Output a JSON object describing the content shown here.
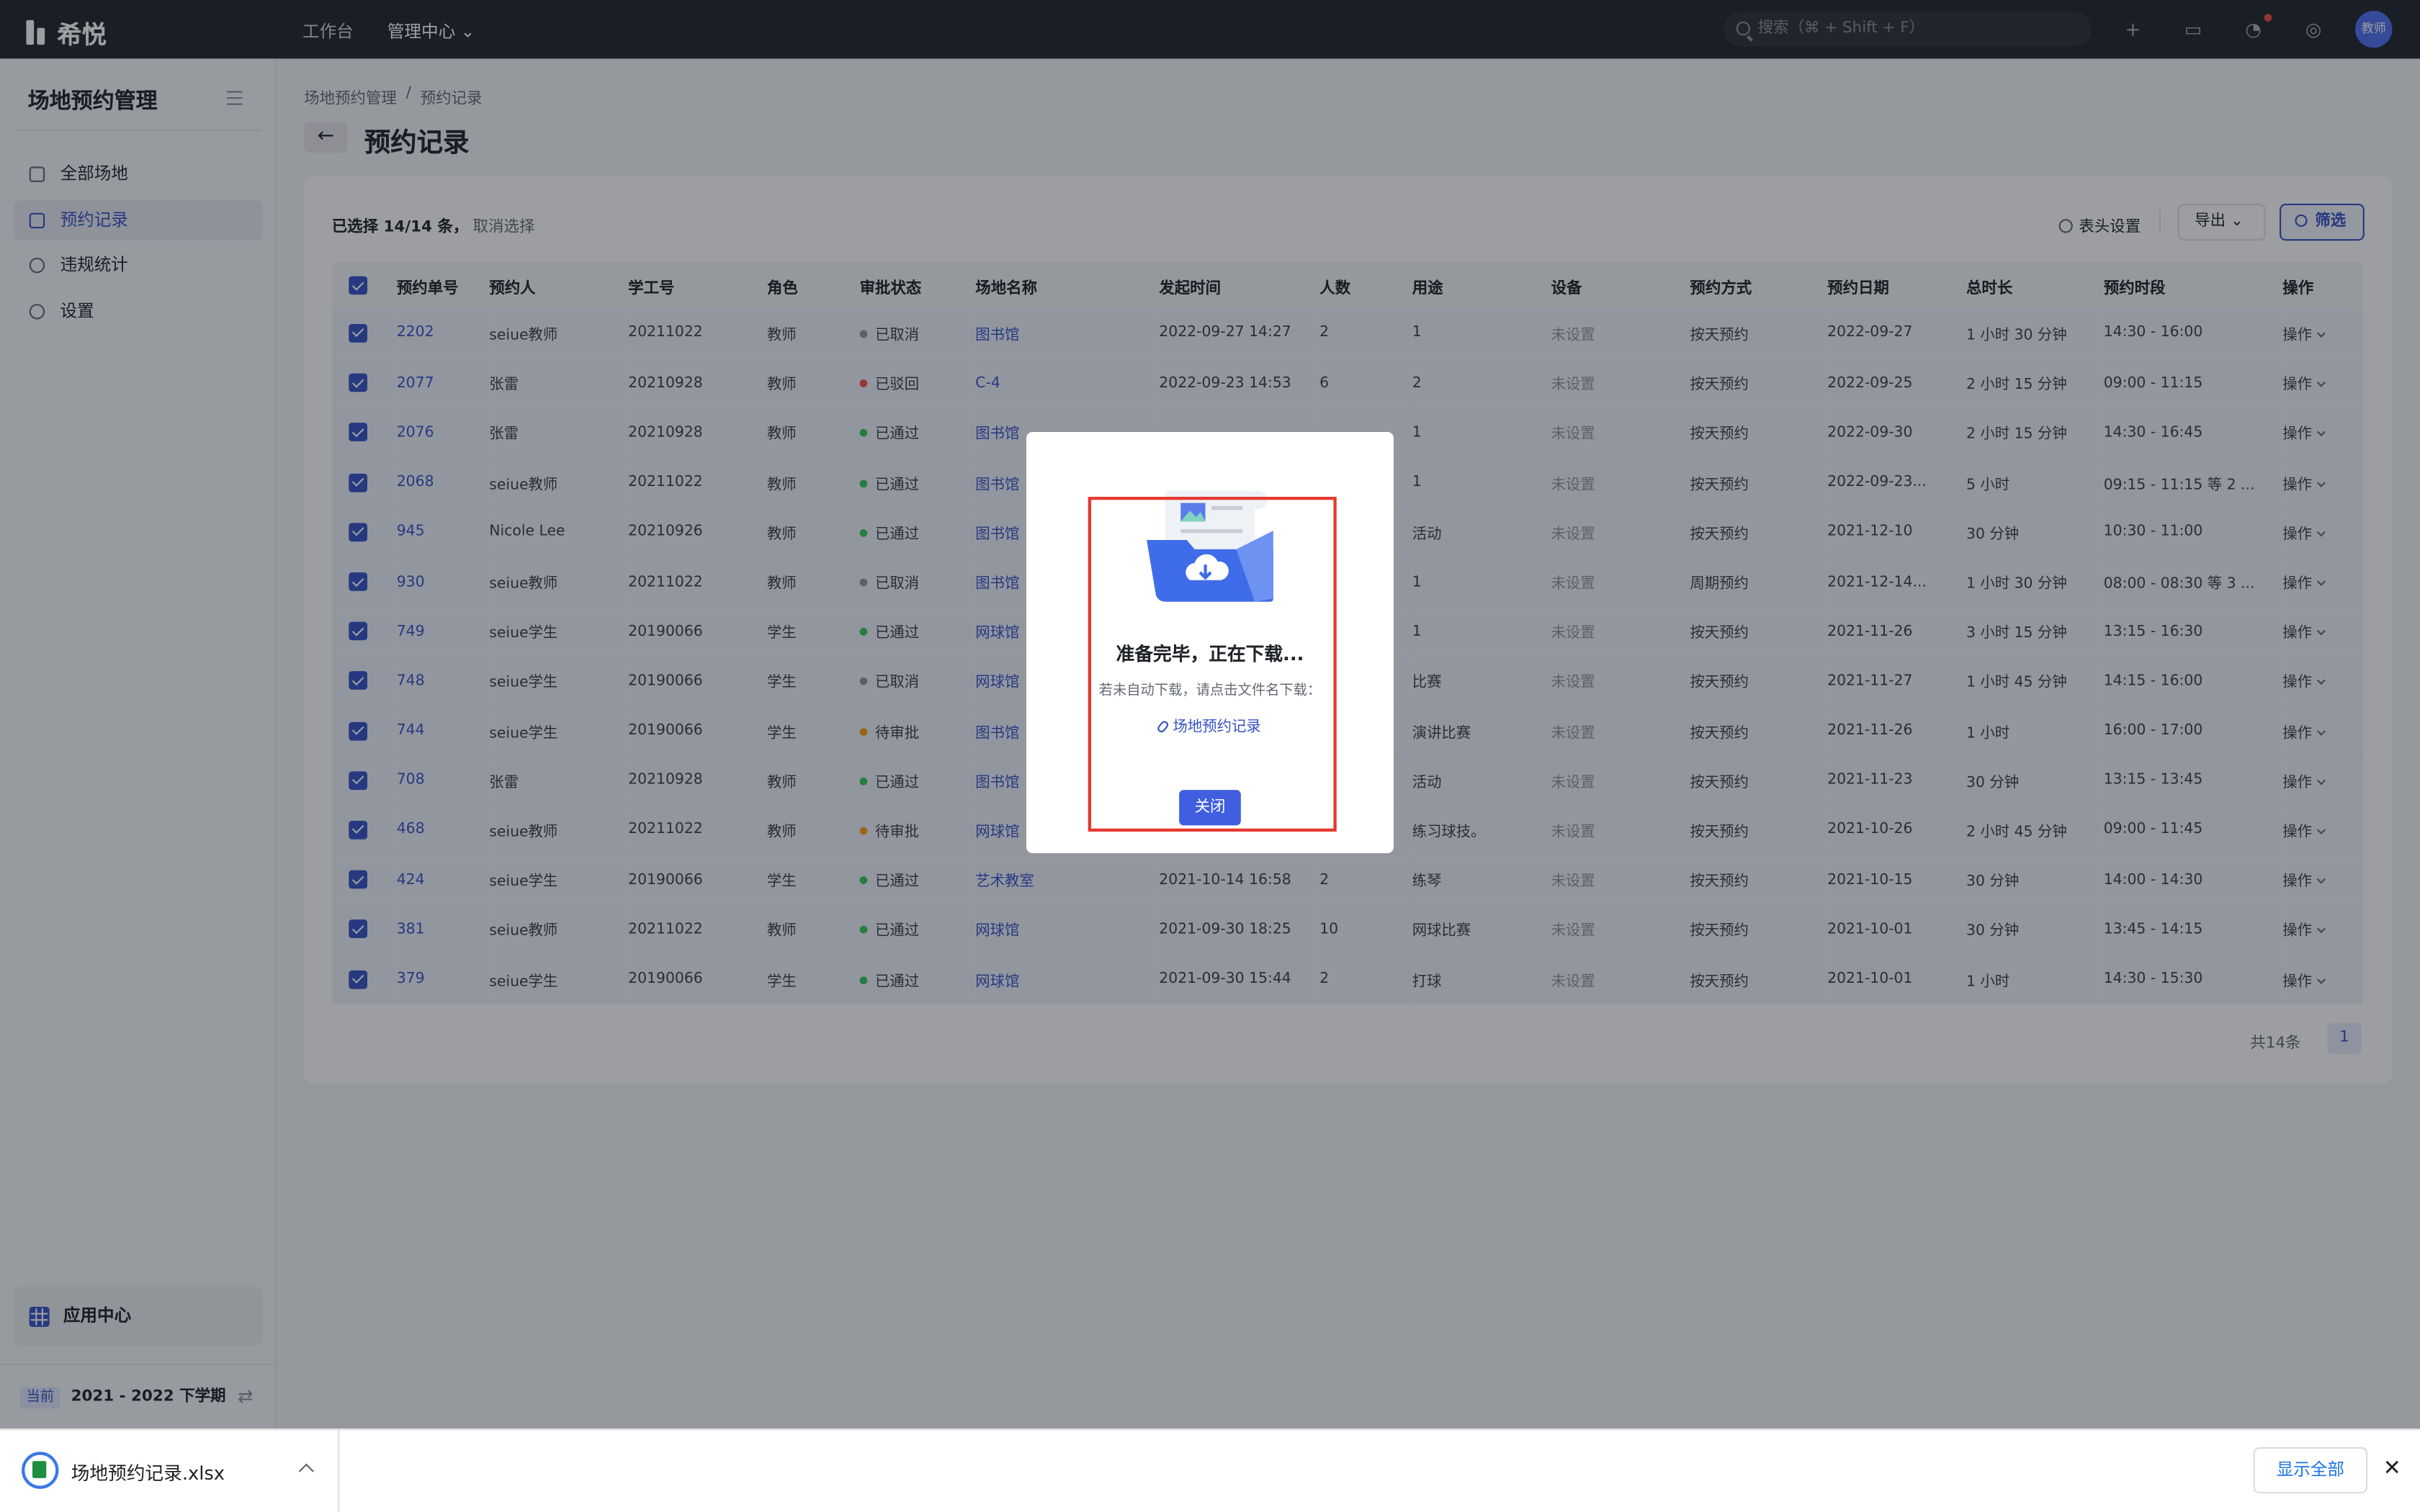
{
  "topbar": {
    "brand": "希悦",
    "nav": [
      "工作台",
      "管理中心"
    ],
    "search_placeholder": "搜索（⌘ + Shift + F）",
    "avatar_text": "教师"
  },
  "sidebar": {
    "title": "场地预约管理",
    "items": [
      {
        "label": "全部场地",
        "icon": "building-icon"
      },
      {
        "label": "预约记录",
        "icon": "list-icon"
      },
      {
        "label": "违规统计",
        "icon": "pie-chart-icon"
      },
      {
        "label": "设置",
        "icon": "gear-icon"
      }
    ],
    "app_center": "应用中心",
    "term_badge": "当前",
    "term": "2021 - 2022 下学期"
  },
  "breadcrumb": [
    "场地预约管理",
    "预约记录"
  ],
  "page_title": "预约记录",
  "toolbar": {
    "selection": "已选择 14/14 条，",
    "clear_selection": "取消选择",
    "header_settings": "表头设置",
    "export": "导出",
    "filter": "筛选"
  },
  "table": {
    "columns": [
      "预约单号",
      "预约人",
      "学工号",
      "角色",
      "审批状态",
      "场地名称",
      "发起时间",
      "人数",
      "用途",
      "设备",
      "预约方式",
      "预约日期",
      "总时长",
      "预约时段",
      "操作"
    ],
    "rows": [
      [
        "2202",
        "seiue教师",
        "20211022",
        "教师",
        "已取消",
        "图书馆",
        "2022-09-27 14:27",
        "2",
        "1",
        "未设置",
        "按天预约",
        "2022-09-27",
        "1 小时 30 分钟",
        "14:30 - 16:00",
        "操作"
      ],
      [
        "2077",
        "张雷",
        "20210928",
        "教师",
        "已驳回",
        "C-4",
        "2022-09-23 14:53",
        "6",
        "2",
        "未设置",
        "按天预约",
        "2022-09-25",
        "2 小时 15 分钟",
        "09:00 - 11:15",
        "操作"
      ],
      [
        "2076",
        "张雷",
        "20210928",
        "教师",
        "已通过",
        "图书馆",
        "",
        "",
        "1",
        "未设置",
        "按天预约",
        "2022-09-30",
        "2 小时 15 分钟",
        "14:30 - 16:45",
        "操作"
      ],
      [
        "2068",
        "seiue教师",
        "20211022",
        "教师",
        "已通过",
        "图书馆",
        "",
        "",
        "1",
        "未设置",
        "按天预约",
        "2022-09-23...",
        "5 小时",
        "09:15 - 11:15 等 2 ...",
        "操作"
      ],
      [
        "945",
        "Nicole Lee",
        "20210926",
        "教师",
        "已通过",
        "图书馆",
        "",
        "",
        "活动",
        "未设置",
        "按天预约",
        "2021-12-10",
        "30 分钟",
        "10:30 - 11:00",
        "操作"
      ],
      [
        "930",
        "seiue教师",
        "20211022",
        "教师",
        "已取消",
        "图书馆",
        "",
        "",
        "1",
        "未设置",
        "周期预约",
        "2021-12-14...",
        "1 小时 30 分钟",
        "08:00 - 08:30 等 3 ...",
        "操作"
      ],
      [
        "749",
        "seiue学生",
        "20190066",
        "学生",
        "已通过",
        "网球馆",
        "",
        "",
        "1",
        "未设置",
        "按天预约",
        "2021-11-26",
        "3 小时 15 分钟",
        "13:15 - 16:30",
        "操作"
      ],
      [
        "748",
        "seiue学生",
        "20190066",
        "学生",
        "已取消",
        "网球馆",
        "",
        "",
        "比赛",
        "未设置",
        "按天预约",
        "2021-11-27",
        "1 小时 45 分钟",
        "14:15 - 16:00",
        "操作"
      ],
      [
        "744",
        "seiue学生",
        "20190066",
        "学生",
        "待审批",
        "图书馆",
        "",
        "",
        "演讲比赛",
        "未设置",
        "按天预约",
        "2021-11-26",
        "1 小时",
        "16:00 - 17:00",
        "操作"
      ],
      [
        "708",
        "张雷",
        "20210928",
        "教师",
        "已通过",
        "图书馆",
        "",
        "",
        "活动",
        "未设置",
        "按天预约",
        "2021-11-23",
        "30 分钟",
        "13:15 - 13:45",
        "操作"
      ],
      [
        "468",
        "seiue教师",
        "20211022",
        "教师",
        "待审批",
        "网球馆",
        "",
        "",
        "练习球技。",
        "未设置",
        "按天预约",
        "2021-10-26",
        "2 小时 45 分钟",
        "09:00 - 11:45",
        "操作"
      ],
      [
        "424",
        "seiue学生",
        "20190066",
        "学生",
        "已通过",
        "艺术教室",
        "2021-10-14 16:58",
        "2",
        "练琴",
        "未设置",
        "按天预约",
        "2021-10-15",
        "30 分钟",
        "14:00 - 14:30",
        "操作"
      ],
      [
        "381",
        "seiue教师",
        "20211022",
        "教师",
        "已通过",
        "网球馆",
        "2021-09-30 18:25",
        "10",
        "网球比赛",
        "未设置",
        "按天预约",
        "2021-10-01",
        "30 分钟",
        "13:45 - 14:15",
        "操作"
      ],
      [
        "379",
        "seiue学生",
        "20190066",
        "学生",
        "已通过",
        "网球馆",
        "2021-09-30 15:44",
        "2",
        "打球",
        "未设置",
        "按天预约",
        "2021-10-01",
        "1 小时",
        "14:30 - 15:30",
        "操作"
      ]
    ],
    "status_colors": {
      "已取消": "#8f959e",
      "已驳回": "#f54a45",
      "已通过": "#34c759",
      "待审批": "#ff9f0a"
    }
  },
  "pagination": {
    "total": "共14条",
    "current": "1"
  },
  "modal": {
    "title": "准备完毕，正在下载...",
    "subtitle": "若未自动下载，请点击文件名下载：",
    "file_link": "场地预约记录",
    "close": "关闭"
  },
  "download_bar": {
    "filename": "场地预约记录.xlsx",
    "show_all": "显示全部"
  }
}
